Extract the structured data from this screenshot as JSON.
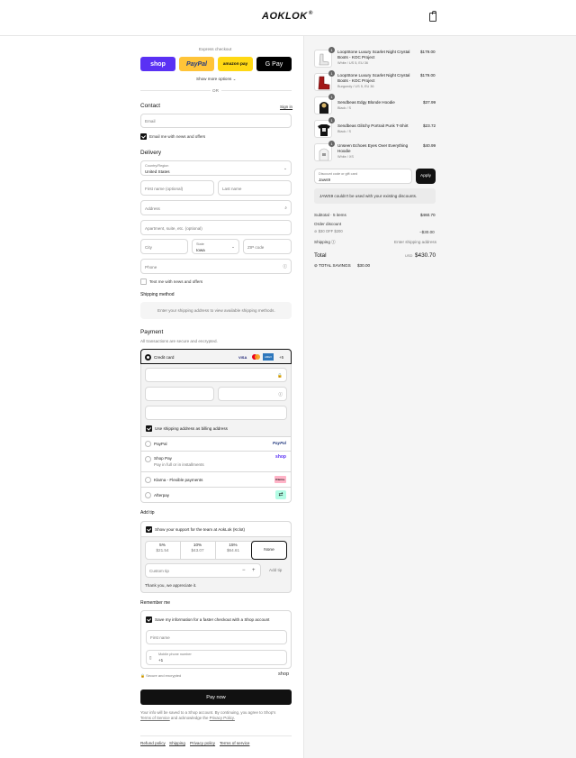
{
  "header": {
    "brand": "AOKLOK"
  },
  "express": {
    "label": "Express checkout",
    "shop": "shop",
    "paypal": "PayPal",
    "amazon": "amazon pay",
    "gpay": "G Pay",
    "more": "Show more options",
    "or": "OR"
  },
  "contact": {
    "title": "Contact",
    "signin": "Sign in",
    "email_ph": "Email",
    "news": "Email me with news and offers"
  },
  "delivery": {
    "title": "Delivery",
    "country_label": "Country/Region",
    "country": "United States",
    "first_ph": "First name (optional)",
    "last_ph": "Last name",
    "address_ph": "Address",
    "apt_ph": "Apartment, suite, etc. (optional)",
    "city_ph": "City",
    "state_label": "State",
    "state": "Iowa",
    "zip_ph": "ZIP code",
    "phone_ph": "Phone",
    "text_me": "Text me with news and offers"
  },
  "shipping": {
    "title": "Shipping method",
    "note": "Enter your shipping address to view available shipping methods."
  },
  "payment": {
    "title": "Payment",
    "subtitle": "All transactions are secure and encrypted.",
    "credit": "Credit card",
    "more_cards": "+5",
    "billing": "Use shipping address as billing address",
    "paypal": "PayPal",
    "shoppay": "Shop Pay",
    "shoppay_sub": "Pay in full or in installments",
    "klarna": "Klarna - Flexible payments",
    "afterpay": "Afterpay",
    "card_visa": "VISA",
    "card_amex": "AMEX",
    "klarna_badge": "Klarna.",
    "shop_badge": "shop"
  },
  "tip": {
    "title": "Add tip",
    "support": "Show your support for the team at AokLok (Kclot)",
    "options": [
      {
        "pct": "5%",
        "amt": "$21.54"
      },
      {
        "pct": "10%",
        "amt": "$43.07"
      },
      {
        "pct": "15%",
        "amt": "$64.61"
      }
    ],
    "none": "None",
    "custom_ph": "Custom tip",
    "add": "Add tip",
    "thanks": "Thank you, we appreciate it."
  },
  "remember": {
    "title": "Remember me",
    "save": "Save my information for a faster checkout with a Shop account",
    "first_ph": "First name",
    "mobile_label": "Mobile phone number",
    "mobile": "+1",
    "secure": "Secure and encrypted",
    "shop": "shop"
  },
  "pay": {
    "button": "Pay now",
    "fine1": "Your info will be saved to a Shop account. By continuing, you agree to Shop's",
    "terms": "Terms of Service",
    "fine2": " and acknowledge the ",
    "privacy": "Privacy Policy."
  },
  "footer": {
    "links": [
      "Refund policy",
      "Shipping",
      "Privacy policy",
      "Terms of service"
    ]
  },
  "summary": {
    "items": [
      {
        "qty": "1",
        "name1": "LoopStone Luxury Scarlet Night Crystal",
        "name2": "Boots - KOC Project",
        "variant": "White / US 5, EU 36",
        "price": "$179.00"
      },
      {
        "qty": "1",
        "name1": "LoopStone Luxury Scarlet Night Crystal",
        "name2": "Boots - KOC Project",
        "variant": "Burgundy / US 5, EU 36",
        "price": "$179.00"
      },
      {
        "qty": "1",
        "name1": "Sendbeas Edgy Blonde Hoodie",
        "name2": "",
        "variant": "Black / S",
        "price": "$37.99"
      },
      {
        "qty": "1",
        "name1": "Sendbeas Glitchy Portrait Punk T-Shirt",
        "name2": "",
        "variant": "Black / S",
        "price": "$23.72"
      },
      {
        "qty": "1",
        "name1": "Unseen Echoes Eyes Over Everything",
        "name2": "Hoodie",
        "variant": "White / XS",
        "price": "$40.99"
      }
    ],
    "discount_label": "Discount code or gift card",
    "discount_value": "Jaws9",
    "apply": "Apply",
    "error": "JAWS9 couldn't be used with your existing discounts.",
    "subtotal_label": "Subtotal · 5 items",
    "subtotal": "$460.70",
    "order_discount": "Order discount",
    "code": "$30 OFF $200",
    "code_amt": "−$30.00",
    "shipping_label": "Shipping",
    "shipping_val": "Enter shipping address",
    "total_label": "Total",
    "currency": "USD",
    "total": "$430.70",
    "savings_label": "TOTAL SAVINGS",
    "savings": "$30.00"
  }
}
